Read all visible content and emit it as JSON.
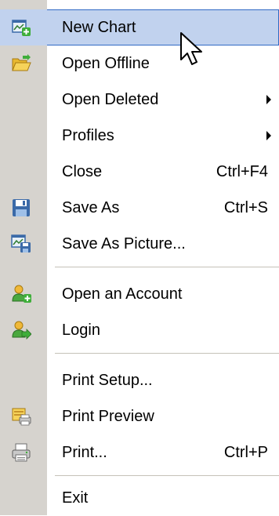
{
  "menu": {
    "items": [
      {
        "label": "New Chart",
        "shortcut": "",
        "submenu": false,
        "icon": "new-chart-icon",
        "highlighted": true
      },
      {
        "label": "Open Offline",
        "shortcut": "",
        "submenu": false,
        "icon": "open-folder-icon"
      },
      {
        "label": "Open Deleted",
        "shortcut": "",
        "submenu": true,
        "icon": ""
      },
      {
        "label": "Profiles",
        "shortcut": "",
        "submenu": true,
        "icon": ""
      },
      {
        "label": "Close",
        "shortcut": "Ctrl+F4",
        "submenu": false,
        "icon": ""
      },
      {
        "label": "Save As",
        "shortcut": "Ctrl+S",
        "submenu": false,
        "icon": "save-icon"
      },
      {
        "label": "Save As Picture...",
        "shortcut": "",
        "submenu": false,
        "icon": "save-picture-icon"
      },
      {
        "label": "Open an Account",
        "shortcut": "",
        "submenu": false,
        "icon": "open-account-icon"
      },
      {
        "label": "Login",
        "shortcut": "",
        "submenu": false,
        "icon": "login-icon"
      },
      {
        "label": "Print Setup...",
        "shortcut": "",
        "submenu": false,
        "icon": ""
      },
      {
        "label": "Print Preview",
        "shortcut": "",
        "submenu": false,
        "icon": "print-preview-icon"
      },
      {
        "label": "Print...",
        "shortcut": "Ctrl+P",
        "submenu": false,
        "icon": "print-icon"
      },
      {
        "label": "Exit",
        "shortcut": "",
        "submenu": false,
        "icon": ""
      }
    ]
  },
  "colors": {
    "icon_strip": "#d6d3ce",
    "highlight": "#c1d2ee",
    "highlight_border": "#316ac5",
    "separator": "#c5c2b8"
  }
}
